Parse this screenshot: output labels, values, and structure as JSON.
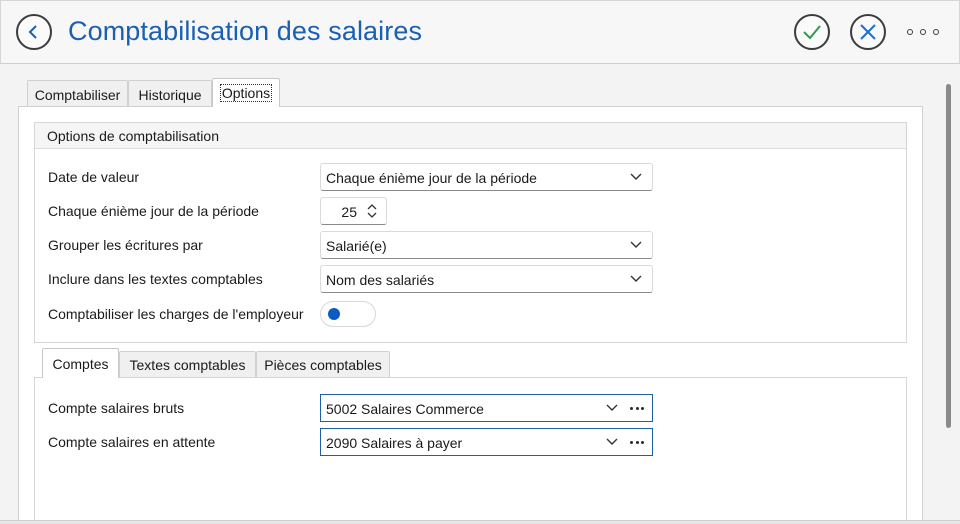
{
  "header": {
    "title": "Comptabilisation des salaires",
    "accent_color": "#1a5fb4",
    "icons": [
      "back-arrow-icon",
      "checkmark-icon",
      "close-x-icon",
      "more-options-icon"
    ]
  },
  "main_tabs": [
    {
      "label": "Comptabiliser",
      "active": false
    },
    {
      "label": "Historique",
      "active": false
    },
    {
      "label": "Options",
      "active": true
    }
  ],
  "options_group": {
    "title": "Options de comptabilisation",
    "fields": {
      "date_valeur": {
        "label": "Date de valeur",
        "value": "Chaque énième jour de la période"
      },
      "enieme_jour": {
        "label": "Chaque énième jour de la période",
        "value": "25"
      },
      "grouper": {
        "label": "Grouper les écritures par",
        "value": "Salarié(e)"
      },
      "inclure": {
        "label": "Inclure dans les textes comptables",
        "value": "Nom des salariés"
      },
      "charges": {
        "label": "Comptabiliser les charges de l'employeur",
        "checked": false
      }
    }
  },
  "sub_tabs": [
    {
      "label": "Comptes",
      "active": true
    },
    {
      "label": "Textes comptables",
      "active": false
    },
    {
      "label": "Pièces comptables",
      "active": false
    }
  ],
  "accounts": {
    "bruts": {
      "label": "Compte salaires bruts",
      "value": "5002 Salaires Commerce"
    },
    "attente": {
      "label": "Compte salaires en attente",
      "value": "2090 Salaires à payer"
    }
  },
  "colors": {
    "toggle_knob": "#0a5bc4",
    "combo_border": "#1f5fa8",
    "ok_icon": "#2f9b4a",
    "cancel_icon": "#1a6fd0"
  }
}
